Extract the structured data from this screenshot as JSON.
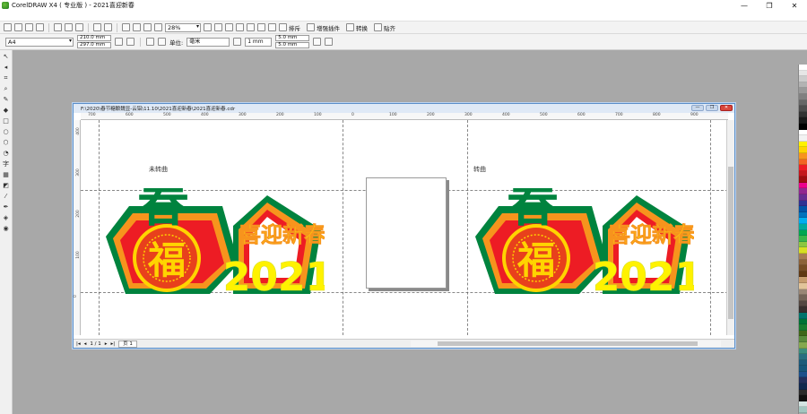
{
  "app": {
    "title": "CorelDRAW X4 ( 专业版 ) - 2021喜迎新春",
    "window_buttons": [
      "—",
      "❐",
      "✕"
    ]
  },
  "toolbar": {
    "zoom": "28%",
    "labels": [
      "排斥",
      "增强插件",
      "转换",
      "贴齐"
    ]
  },
  "propbar": {
    "paper": "A4",
    "width": "210.0 mm",
    "height": "297.0 mm",
    "unit_label": "单位:",
    "unit": "毫米",
    "nudge": "1 mm",
    "dup_x": "5.0 mm",
    "dup_y": "5.0 mm"
  },
  "document": {
    "path": "F:\\2020\\春节糖酿魏显-云铝\\11.10\\2021喜迎新春\\2021喜迎新春.cdr",
    "ruler_top": [
      "700",
      "600",
      "500",
      "400",
      "300",
      "200",
      "100",
      "0",
      "100",
      "200",
      "300",
      "400",
      "500",
      "600",
      "700",
      "800",
      "900"
    ],
    "ruler_left": [
      "400",
      "300",
      "200",
      "100",
      "0"
    ],
    "label_left": "未转曲",
    "label_right": "转曲",
    "artwork_text": {
      "chun": "春",
      "fu": "福",
      "slogan": "喜迎新春",
      "year": "2021"
    },
    "page_counter": "1 / 1",
    "page_tab": "页 1"
  },
  "palette_colors": [
    "#ffffff",
    "#e6e6e6",
    "#cccccc",
    "#b3b3b3",
    "#999999",
    "#808080",
    "#666666",
    "#4d4d4d",
    "#333333",
    "#1a1a1a",
    "#000000",
    "#ffffff",
    "#f2f2f2",
    "#fff200",
    "#ffd400",
    "#f7941d",
    "#f26522",
    "#ed1c24",
    "#c4161c",
    "#9e0b0f",
    "#ec008c",
    "#92278f",
    "#662d91",
    "#2e3192",
    "#0054a6",
    "#0072bc",
    "#00aeef",
    "#00a99d",
    "#00a651",
    "#39b54a",
    "#8dc63f",
    "#d7df23",
    "#a67c52",
    "#8c6239",
    "#754c24",
    "#603913",
    "#c69c6d",
    "#e2c49a",
    "#998675",
    "#736357",
    "#534741",
    "#362f2d",
    "#00746b",
    "#007236",
    "#197b30",
    "#406618",
    "#5a8a3c",
    "#85a84f",
    "#3c8d7c",
    "#2a6f7f",
    "#1d5a7a",
    "#175579",
    "#1b4f8a",
    "#222f5b",
    "#10284d",
    "#2b2b2b",
    "#111111",
    "#d4e4e2",
    "#a3c6c0"
  ]
}
